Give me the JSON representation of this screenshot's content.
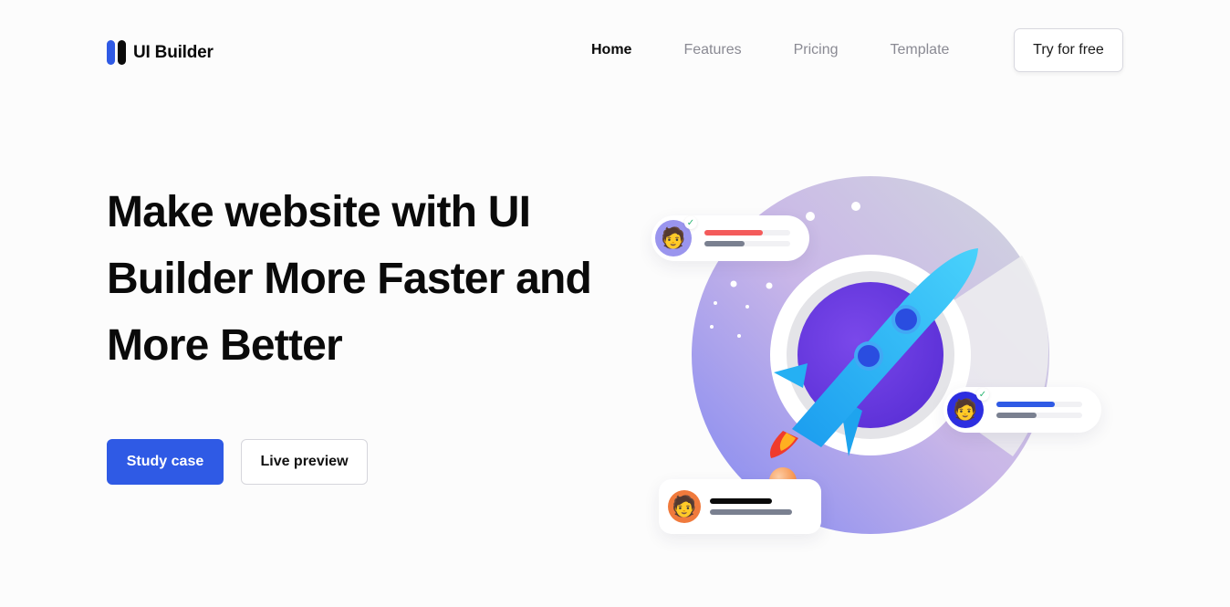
{
  "brand": {
    "name": "UI Builder",
    "accent": "#2f5ae5"
  },
  "nav": {
    "items": [
      {
        "label": "Home",
        "active": true
      },
      {
        "label": "Features",
        "active": false
      },
      {
        "label": "Pricing",
        "active": false
      },
      {
        "label": "Template",
        "active": false
      }
    ],
    "cta": "Try for free"
  },
  "hero": {
    "title": "Make website with UI Builder More Faster and More Better",
    "primary_button": "Study case",
    "secondary_button": "Live preview"
  },
  "illustration": {
    "icon": "rocket-icon",
    "cards": [
      {
        "avatar": "memoji-man-icon",
        "avatar_bg": "#9a95ee",
        "verified": true,
        "bar1_color": "#f45b5b",
        "bar1_fill": 0.68,
        "bar2_color": "#7a8090",
        "bar2_fill": 0.47
      },
      {
        "avatar": "memoji-glasses-icon",
        "avatar_bg": "#2d2ee0",
        "verified": true,
        "bar1_color": "#2f5ae5",
        "bar1_fill": 0.68,
        "bar2_color": "#7a8090",
        "bar2_fill": 0.47
      },
      {
        "avatar": "memoji-surprised-icon",
        "avatar_bg": "#f07a3c",
        "verified": false,
        "bar1_color": "#0a0a0a",
        "bar1_fill": 0.75,
        "bar2_color": "#7a8090",
        "bar2_fill": 1.0
      }
    ]
  }
}
